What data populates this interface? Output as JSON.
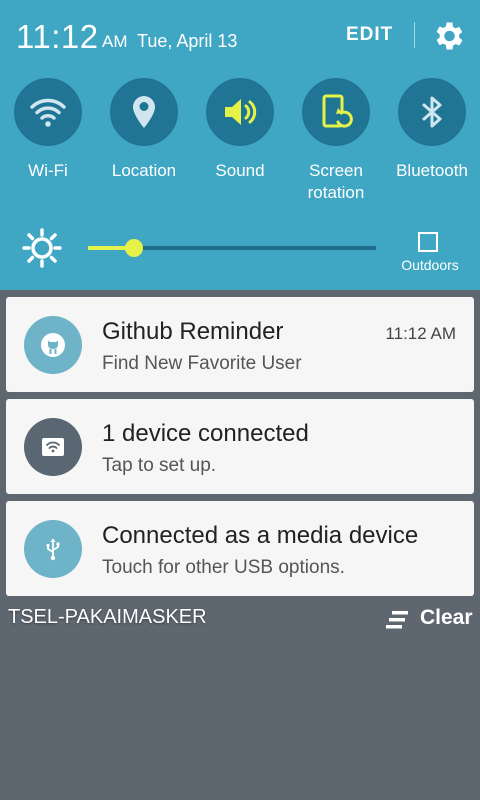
{
  "status": {
    "time": "11:12",
    "ampm": "AM",
    "date": "Tue, April 13",
    "edit_label": "EDIT"
  },
  "toggles": [
    {
      "label": "Wi-Fi",
      "icon": "wifi-icon",
      "active": false
    },
    {
      "label": "Location",
      "icon": "location-icon",
      "active": false
    },
    {
      "label": "Sound",
      "icon": "sound-icon",
      "active": true
    },
    {
      "label": "Screen rotation",
      "icon": "screen-rotation-icon",
      "active": true
    },
    {
      "label": "Bluetooth",
      "icon": "bluetooth-icon",
      "active": false
    }
  ],
  "brightness": {
    "level": 0.16,
    "outdoors_label": "Outdoors"
  },
  "notifications": [
    {
      "title": "Github Reminder",
      "subtitle": "Find New Favorite User",
      "time": "11:12 AM",
      "icon": "github-icon",
      "icon_bg": "#6fb3c8"
    },
    {
      "title": "1 device connected",
      "subtitle": "Tap to set up.",
      "time": "",
      "icon": "wifi-hotspot-icon",
      "icon_bg": "#5a6772"
    },
    {
      "title": "Connected as a media device",
      "subtitle": "Touch for other USB options.",
      "time": "",
      "icon": "usb-icon",
      "icon_bg": "#6fb3c8"
    }
  ],
  "footer": {
    "carrier": "TSEL-PAKAIMASKER",
    "clear_label": "Clear"
  },
  "colors": {
    "panel": "#3fa6c4",
    "toggle_bg": "#1f7593",
    "accent": "#e4f24a",
    "shade": "#5e6770"
  }
}
